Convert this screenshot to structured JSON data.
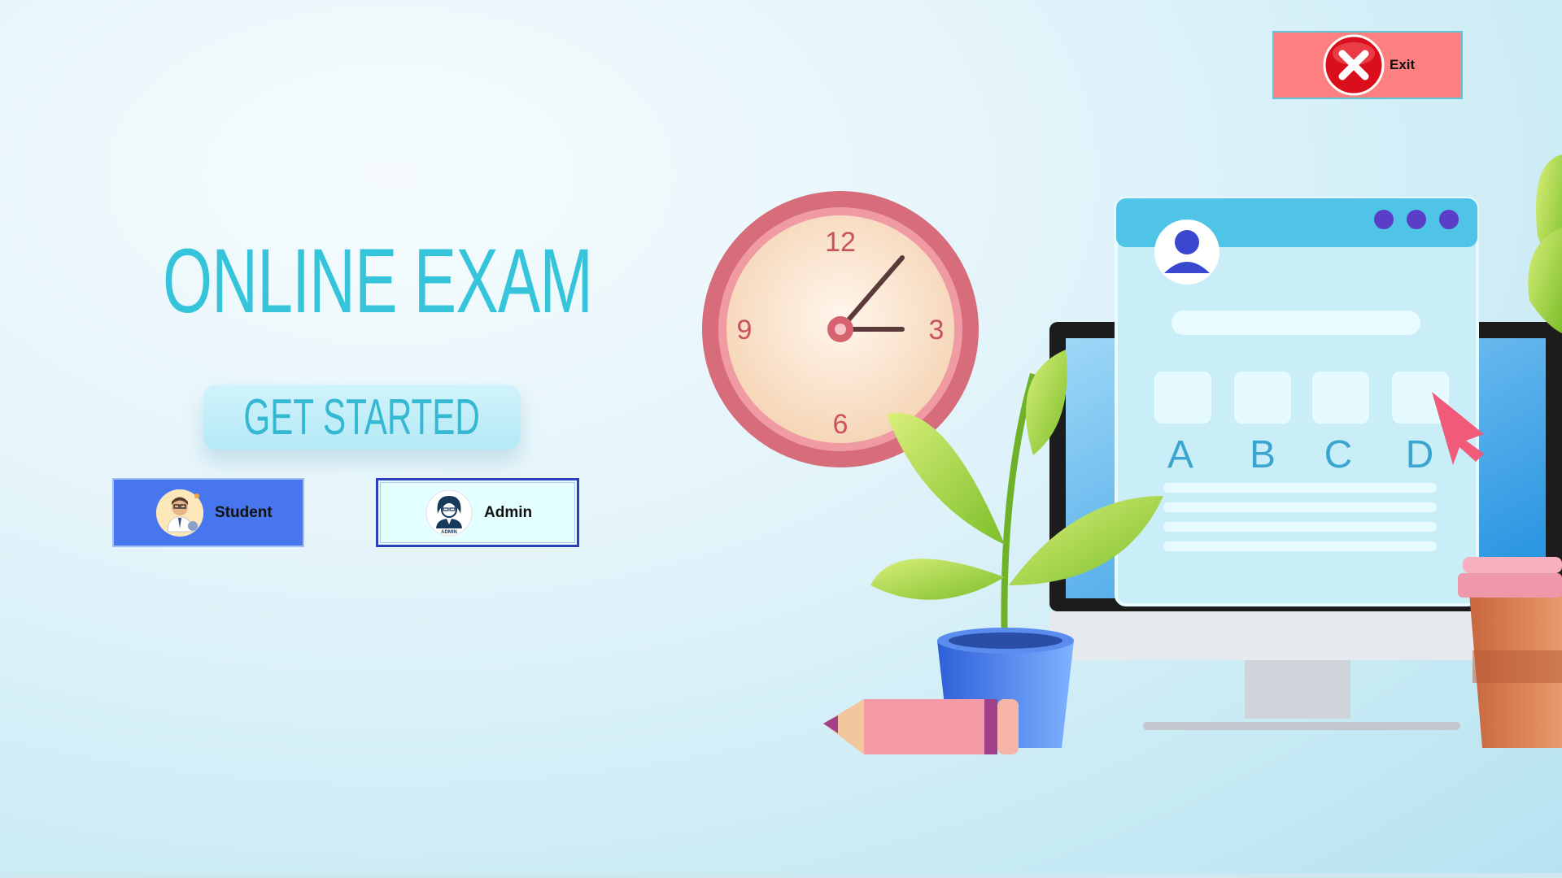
{
  "app": {
    "title": "ONLINE EXAM",
    "get_started_label": "GET STARTED"
  },
  "roles": {
    "student_label": "Student",
    "admin_label": "Admin",
    "admin_badge": "ADMIN"
  },
  "exit": {
    "label": "Exit",
    "icon": "close-icon"
  },
  "illustration": {
    "clock_numbers": [
      "12",
      "3",
      "6",
      "9"
    ],
    "options": [
      "A",
      "B",
      "C",
      "D"
    ]
  },
  "colors": {
    "accent": "#36c4db",
    "student_button": "#4876ee",
    "admin_button": "#e4ffff",
    "exit_button": "#fe8080"
  }
}
